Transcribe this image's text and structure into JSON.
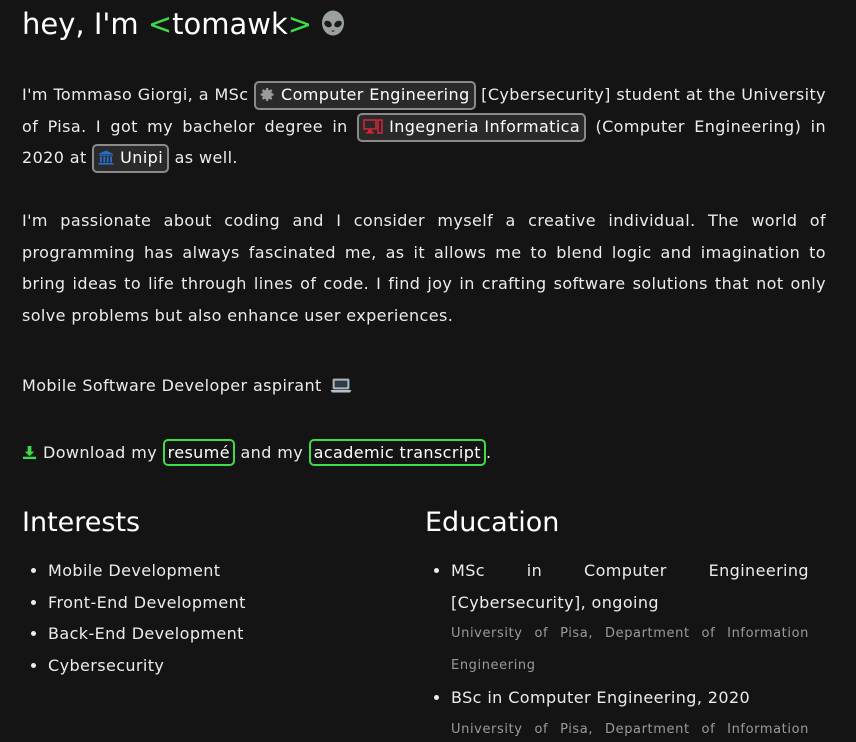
{
  "header": {
    "greeting": "hey, I'm",
    "open_bracket": "<",
    "handle": "tomawk",
    "close_bracket": ">",
    "emoji_icon": "alien-icon"
  },
  "intro": {
    "t1": "I'm Tommaso Giorgi, a MSc ",
    "chip_degree": "Computer Engineering",
    "chip_degree_icon": "gear-icon",
    "t2": " [Cybersecurity] student at the University of Pisa. I got my bachelor degree in ",
    "chip_bachelor": "Ingegneria Informatica",
    "chip_bachelor_icon": "computer-icon",
    "t3": " (Computer Engineering) in 2020 at ",
    "chip_uni": "Unipi",
    "chip_uni_icon": "university-icon",
    "t4": " as well."
  },
  "passion": "I'm passionate about coding and I consider myself a creative individual. The world of programming has always fascinated me, as it allows me to blend logic and imagination to bring ideas to life through lines of code. I find joy in crafting software solutions that not only solve problems but also enhance user experiences.",
  "aspiration": "Mobile Software Developer aspirant",
  "download": {
    "t1": "Download my",
    "resume": "resumé",
    "t2": "and my",
    "transcript": "academic transcript",
    "t3": "."
  },
  "interests": {
    "title": "Interests",
    "items": [
      "Mobile Development",
      "Front-End Development",
      "Back-End Development",
      "Cybersecurity"
    ]
  },
  "education": {
    "title": "Education",
    "items": [
      {
        "degree": "MSc in Computer Engineering [Cybersecurity], ongoing",
        "place": "University of Pisa, Department of Information Engineering"
      },
      {
        "degree": "BSc in Computer Engineering, 2020",
        "place": "University of Pisa, Department of Information Engineering"
      }
    ]
  },
  "colors": {
    "background": "#141414",
    "accent_green": "#3fdc4a",
    "chip_border": "#8a8a8a",
    "muted_text": "#9a9a9a"
  }
}
